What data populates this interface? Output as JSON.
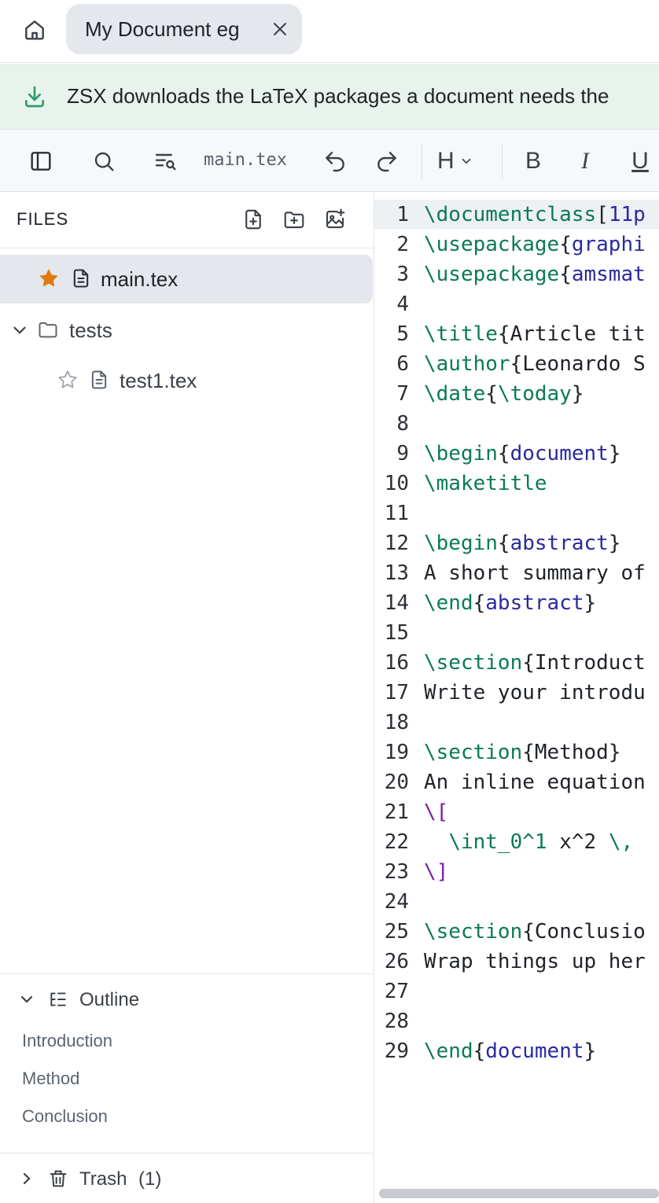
{
  "tabbar": {
    "home_icon": "home-icon",
    "tab_title": "My Document eg",
    "close_icon": "close-icon"
  },
  "banner": {
    "icon": "download-icon",
    "text": "ZSX downloads the LaTeX packages a document needs the",
    "accent": "#2e9e6a"
  },
  "toolbar": {
    "file_name": "main.tex",
    "heading_label": "H",
    "bold_label": "B",
    "italic_label": "I",
    "underline_label": "U",
    "icons": [
      "sidebar-toggle-icon",
      "search-icon",
      "find-replace-icon",
      "undo-icon",
      "redo-icon",
      "chevron-down-icon"
    ]
  },
  "sidebar": {
    "files_title": "FILES",
    "header_icons": [
      "new-file-icon",
      "new-folder-icon",
      "add-image-icon"
    ],
    "tree": [
      {
        "label": "main.tex",
        "starred": true,
        "selected": true
      },
      {
        "label": "tests",
        "type": "folder",
        "expanded": true
      },
      {
        "label": "test1.tex",
        "starred": false
      }
    ],
    "star_color": "#e07b10"
  },
  "outline": {
    "title": "Outline",
    "items": [
      "Introduction",
      "Method",
      "Conclusion"
    ]
  },
  "trash": {
    "label": "Trash",
    "count": "(1)"
  },
  "editor": {
    "active_line": 1,
    "lines": [
      {
        "n": "1",
        "parts": [
          [
            "k",
            "\\documentclass"
          ],
          [
            "b",
            "["
          ],
          [
            "a",
            "11p"
          ]
        ]
      },
      {
        "n": "2",
        "parts": [
          [
            "k",
            "\\usepackage"
          ],
          [
            "b",
            "{"
          ],
          [
            "a",
            "graphi"
          ]
        ]
      },
      {
        "n": "3",
        "parts": [
          [
            "k",
            "\\usepackage"
          ],
          [
            "b",
            "{"
          ],
          [
            "a",
            "amsmat"
          ]
        ]
      },
      {
        "n": "4",
        "parts": []
      },
      {
        "n": "5",
        "parts": [
          [
            "k",
            "\\title"
          ],
          [
            "b",
            "{"
          ],
          [
            "t",
            "Article tit"
          ]
        ]
      },
      {
        "n": "6",
        "parts": [
          [
            "k",
            "\\author"
          ],
          [
            "b",
            "{"
          ],
          [
            "t",
            "Leonardo S"
          ]
        ]
      },
      {
        "n": "7",
        "parts": [
          [
            "k",
            "\\date"
          ],
          [
            "b",
            "{"
          ],
          [
            "k",
            "\\today"
          ],
          [
            "b",
            "}"
          ]
        ]
      },
      {
        "n": "8",
        "parts": []
      },
      {
        "n": "9",
        "parts": [
          [
            "k",
            "\\begin"
          ],
          [
            "b",
            "{"
          ],
          [
            "a",
            "document"
          ],
          [
            "b",
            "}"
          ]
        ]
      },
      {
        "n": "10",
        "parts": [
          [
            "k",
            "\\maketitle"
          ]
        ]
      },
      {
        "n": "11",
        "parts": []
      },
      {
        "n": "12",
        "parts": [
          [
            "k",
            "\\begin"
          ],
          [
            "b",
            "{"
          ],
          [
            "a",
            "abstract"
          ],
          [
            "b",
            "}"
          ]
        ]
      },
      {
        "n": "13",
        "parts": [
          [
            "t",
            "A short summary of"
          ]
        ]
      },
      {
        "n": "14",
        "parts": [
          [
            "k",
            "\\end"
          ],
          [
            "b",
            "{"
          ],
          [
            "a",
            "abstract"
          ],
          [
            "b",
            "}"
          ]
        ]
      },
      {
        "n": "15",
        "parts": []
      },
      {
        "n": "16",
        "parts": [
          [
            "k",
            "\\section"
          ],
          [
            "b",
            "{"
          ],
          [
            "t",
            "Introduct"
          ]
        ]
      },
      {
        "n": "17",
        "parts": [
          [
            "t",
            "Write your introdu"
          ]
        ]
      },
      {
        "n": "18",
        "parts": []
      },
      {
        "n": "19",
        "parts": [
          [
            "k",
            "\\section"
          ],
          [
            "b",
            "{"
          ],
          [
            "t",
            "Method"
          ],
          [
            "b",
            "}"
          ]
        ]
      },
      {
        "n": "20",
        "parts": [
          [
            "t",
            "An inline equation"
          ]
        ]
      },
      {
        "n": "21",
        "parts": [
          [
            "m",
            "\\["
          ]
        ]
      },
      {
        "n": "22",
        "parts": [
          [
            "t",
            "  "
          ],
          [
            "k",
            "\\int_0^1"
          ],
          [
            "t",
            " x^2 "
          ],
          [
            "k",
            "\\,"
          ]
        ]
      },
      {
        "n": "23",
        "parts": [
          [
            "m",
            "\\]"
          ]
        ]
      },
      {
        "n": "24",
        "parts": []
      },
      {
        "n": "25",
        "parts": [
          [
            "k",
            "\\section"
          ],
          [
            "b",
            "{"
          ],
          [
            "t",
            "Conclusio"
          ]
        ]
      },
      {
        "n": "26",
        "parts": [
          [
            "t",
            "Wrap things up her"
          ]
        ]
      },
      {
        "n": "27",
        "parts": []
      },
      {
        "n": "28",
        "parts": []
      },
      {
        "n": "29",
        "parts": [
          [
            "k",
            "\\end"
          ],
          [
            "b",
            "{"
          ],
          [
            "a",
            "document"
          ],
          [
            "b",
            "}"
          ]
        ]
      }
    ]
  }
}
